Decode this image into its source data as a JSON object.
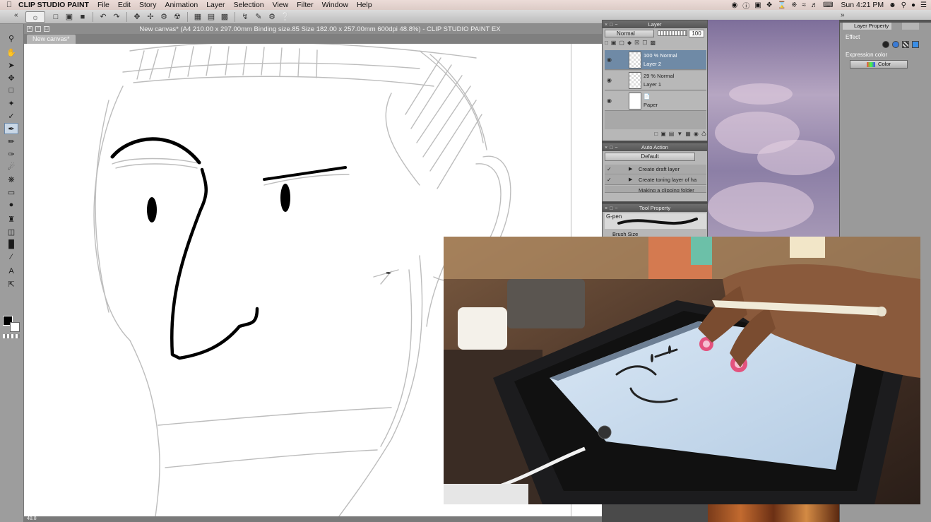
{
  "menubar": {
    "app_name": "CLIP STUDIO PAINT",
    "menus": [
      "File",
      "Edit",
      "Story",
      "Animation",
      "Layer",
      "Selection",
      "View",
      "Filter",
      "Window",
      "Help"
    ],
    "clock": "Sun 4:21 PM"
  },
  "document": {
    "title": "New canvas* (A4 210.00 x 297.00mm Binding size.85 Size 182.00 x 257.00mm 600dpi 48.8%)  - CLIP STUDIO PAINT EX",
    "tab": "New canvas*",
    "status": "48.8"
  },
  "layer_panel": {
    "title": "Layer",
    "blend_mode": "Normal",
    "opacity": "100",
    "layers": [
      {
        "line1": "100 % Normal",
        "line2": "Layer 2",
        "selected": true
      },
      {
        "line1": "29 % Normal",
        "line2": "Layer 1",
        "selected": false
      },
      {
        "line1": "",
        "line2": "Paper",
        "selected": false
      }
    ]
  },
  "auto_action": {
    "title": "Auto Action",
    "set": "Default",
    "items": [
      "Create draft layer",
      "Create toning layer of ha",
      "Making a clipping folder"
    ]
  },
  "tool_property": {
    "title": "Tool Property",
    "tool": "G-pen",
    "brush_size_label": "Brush Size"
  },
  "layer_property": {
    "tab": "Layer Property",
    "effect_label": "Effect",
    "expression_color_label": "Expression color",
    "expression_color_value": "Color"
  },
  "colors": {
    "selected_layer": "#6f8aa6",
    "ink": "#000000",
    "sketch": "#bdbdbd"
  }
}
